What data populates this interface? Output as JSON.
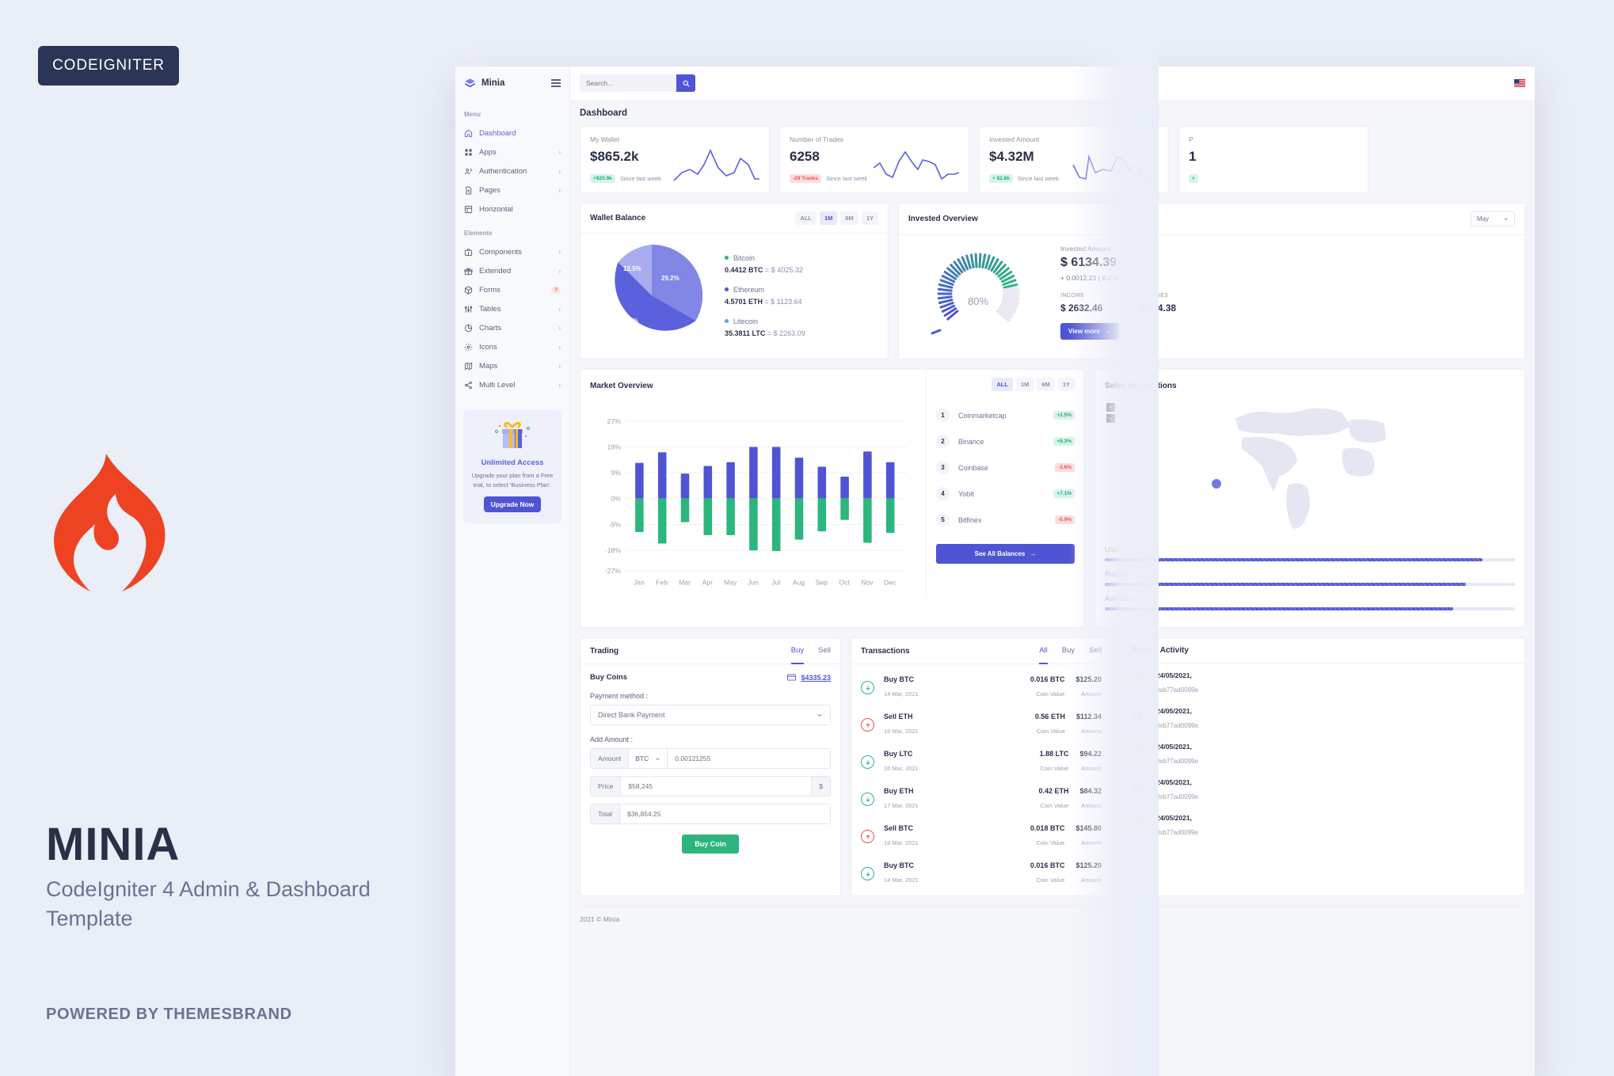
{
  "promo": {
    "badge": "CODEIGNITER",
    "title": "MINIA",
    "subtitle": "CodeIgniter 4 Admin & Dashboard Template",
    "powered_by": "POWERED BY THEMESBRAND",
    "flame_color": "#ee4323",
    "badge_bg": "#2b3657"
  },
  "sidebar": {
    "brand": "Minia",
    "sections": [
      {
        "label": "Menu",
        "items": [
          {
            "label": "Dashboard",
            "icon": "home-icon",
            "arrow": "",
            "active": true
          },
          {
            "label": "Apps",
            "icon": "grid-icon",
            "arrow": "›"
          },
          {
            "label": "Authentication",
            "icon": "users-icon",
            "arrow": "›"
          },
          {
            "label": "Pages",
            "icon": "file-icon",
            "arrow": "›"
          },
          {
            "label": "Horizontal",
            "icon": "layout-icon",
            "arrow": ""
          }
        ]
      },
      {
        "label": "Elements",
        "items": [
          {
            "label": "Components",
            "icon": "briefcase-icon",
            "arrow": "›"
          },
          {
            "label": "Extended",
            "icon": "gift-icon",
            "arrow": "›"
          },
          {
            "label": "Forms",
            "icon": "box-icon",
            "badge": "7"
          },
          {
            "label": "Tables",
            "icon": "sliders-icon",
            "arrow": "›"
          },
          {
            "label": "Charts",
            "icon": "pie-chart-icon",
            "arrow": "›"
          },
          {
            "label": "Icons",
            "icon": "gear-icon",
            "arrow": "›"
          },
          {
            "label": "Maps",
            "icon": "map-icon",
            "arrow": "›"
          },
          {
            "label": "Multi Level",
            "icon": "share-icon",
            "arrow": "›"
          }
        ]
      }
    ],
    "promo": {
      "title": "Unlimited Access",
      "text": "Upgrade your plan from a Free trial, to select 'Business Plan'.",
      "button": "Upgrade Now"
    }
  },
  "topbar": {
    "search_placeholder": "Search...",
    "search_icon": "search-icon",
    "flag_icon": "usa-flag-icon"
  },
  "main": {
    "page_title": "Dashboard",
    "footer": "2021 © Minia",
    "stats": [
      {
        "label": "My Wallet",
        "value": "$865.2k",
        "pill": "+$20.9k",
        "pill_dir": "up",
        "since": "Since last week"
      },
      {
        "label": "Number of Trades",
        "value": "6258",
        "pill": "-29 Trades",
        "pill_dir": "down",
        "since": "Since last week"
      },
      {
        "label": "Invested Amount",
        "value": "$4.32M",
        "pill": "+ $2.8k",
        "pill_dir": "up",
        "since": "Since last week"
      },
      {
        "label": "P",
        "value": "1",
        "pill": "+",
        "pill_dir": "up",
        "since": ""
      }
    ],
    "wallet": {
      "title": "Wallet Balance",
      "ranges": [
        "ALL",
        "1M",
        "6M",
        "1Y"
      ],
      "active_range": "1M",
      "coins": [
        {
          "name": "Bitcoin",
          "color": "#2cb67d",
          "amount": "0.4412 BTC",
          "value": "= $ 4025.32"
        },
        {
          "name": "Ethereum",
          "color": "#4f54d4",
          "amount": "4.5701 ETH",
          "value": "= $ 1123.64"
        },
        {
          "name": "Litecoin",
          "color": "#50a5f1",
          "amount": "35.3811 LTC",
          "value": "= $ 2263.09"
        }
      ]
    },
    "invested": {
      "title": "Invested Overview",
      "month": "May",
      "amount_label": "Invested Amount",
      "amount": "$ 6134.39",
      "delta": "+ 0.0012.23 ( 0.2 % )",
      "delta_arrow": "↑",
      "gauge_pct": "80%",
      "income_label": "INCOME",
      "income": "$ 2632.46",
      "expenses_label": "EXPENSES",
      "expenses": "-$ 924.38",
      "view_more": "View more",
      "view_more_arrow": "→"
    },
    "market": {
      "title": "Market Overview",
      "ranges": [
        "ALL",
        "1M",
        "6M",
        "1Y"
      ],
      "active_range": "ALL"
    },
    "balances": {
      "ranges": [
        "ALL",
        "1M",
        "6M",
        "1Y"
      ],
      "active_range": "ALL",
      "rows": [
        {
          "rank": "1",
          "name": "Coinmarketcap",
          "change": "+2.5%",
          "dir": "up"
        },
        {
          "rank": "2",
          "name": "Binance",
          "change": "+8.3%",
          "dir": "up"
        },
        {
          "rank": "3",
          "name": "Coinbase",
          "change": "-3.6%",
          "dir": "down"
        },
        {
          "rank": "4",
          "name": "Yobit",
          "change": "+7.1%",
          "dir": "up"
        },
        {
          "rank": "5",
          "name": "Bitfinex",
          "change": "-0.9%",
          "dir": "down"
        }
      ],
      "button": "See All Balances",
      "button_arrow": "→"
    },
    "locations": {
      "title": "Sales by Locations",
      "zoom_in": "+",
      "zoom_out": "−",
      "items": [
        {
          "name": "USA",
          "pct": 92
        },
        {
          "name": "Russia",
          "pct": 88
        },
        {
          "name": "Australia",
          "pct": 85
        }
      ]
    },
    "trading": {
      "title": "Trading",
      "tabs": [
        "Buy",
        "Sell"
      ],
      "active_tab": "Buy",
      "buy_coins_label": "Buy Coins",
      "wallet_icon": "wallet-icon",
      "wallet_amount": "$4335.23",
      "payment_method_label": "Payment method :",
      "payment_method_value": "Direct Bank Payment",
      "add_amount_label": "Add Amount :",
      "amount_addon": "Amount",
      "amount_currency": "BTC",
      "amount_placeholder": "0.00121255",
      "price_addon": "Price",
      "price_placeholder": "$58,245",
      "price_suffix": "$",
      "total_addon": "Total",
      "total_placeholder": "$36,854.25",
      "buy_button": "Buy Coin"
    },
    "transactions": {
      "title": "Transactions",
      "tabs": [
        "All",
        "Buy",
        "Sell"
      ],
      "active_tab": "All",
      "coin_value_label": "Coin Value",
      "amount_label": "Amount",
      "rows": [
        {
          "title": "Buy BTC",
          "date": "14 Mar, 2021",
          "coin": "0.016 BTC",
          "amount": "$125.20",
          "dir": "buy"
        },
        {
          "title": "Sell ETH",
          "date": "16 Mar, 2021",
          "coin": "0.56 ETH",
          "amount": "$112.34",
          "dir": "sell"
        },
        {
          "title": "Buy LTC",
          "date": "16 Mar, 2021",
          "coin": "1.88 LTC",
          "amount": "$94.22",
          "dir": "buy"
        },
        {
          "title": "Buy ETH",
          "date": "17 Mar, 2021",
          "coin": "0.42 ETH",
          "amount": "$84.32",
          "dir": "buy"
        },
        {
          "title": "Sell BTC",
          "date": "18 Mar, 2021",
          "coin": "0.018 BTC",
          "amount": "$145.80",
          "dir": "sell"
        },
        {
          "title": "Buy BTC",
          "date": "14 Mar, 2021",
          "coin": "0.016 BTC",
          "amount": "$125.20",
          "dir": "buy"
        }
      ]
    },
    "activity": {
      "title": "Recent Activity",
      "rows": [
        {
          "date": "24/05/2021,",
          "hash": "0xb77ad0099e",
          "coin": "B",
          "bg": "#fdecd0",
          "fg": "#f0a73e"
        },
        {
          "date": "24/05/2021,",
          "hash": "0xb77ad0099e",
          "coin": "♦",
          "bg": "#dcdef7",
          "fg": "#4f54d4"
        },
        {
          "date": "24/05/2021,",
          "hash": "0xb77ad0099e",
          "coin": "B",
          "bg": "#fdecd0",
          "fg": "#f0a73e"
        },
        {
          "date": "24/05/2021,",
          "hash": "0xb77ad0099e",
          "coin": "Ł",
          "bg": "#dcdef7",
          "fg": "#5b61dd"
        },
        {
          "date": "24/05/2021,",
          "hash": "0xb77ad0099e",
          "coin": "B",
          "bg": "#fdecd0",
          "fg": "#f0a73e"
        }
      ]
    }
  },
  "chart_data": [
    {
      "type": "pie",
      "title": "Wallet Balance",
      "labels": [
        "Ethereum",
        "Bitcoin",
        "Litecoin"
      ],
      "values": [
        58.3,
        29.2,
        12.5
      ],
      "value_labels": [
        "58.3%",
        "29.2%",
        "12.5%"
      ],
      "colors": [
        "#5b61dd",
        "#8287e6",
        "#a9adf0"
      ]
    },
    {
      "type": "bar",
      "title": "Market Overview",
      "categories": [
        "Jan",
        "Feb",
        "Mar",
        "Apr",
        "May",
        "Jun",
        "Jul",
        "Aug",
        "Sep",
        "Oct",
        "Nov",
        "Dec"
      ],
      "series": [
        {
          "name": "Gain",
          "color": "#4f54d4",
          "values": [
            12.4,
            16.2,
            8.7,
            11.5,
            12.6,
            18.0,
            18.1,
            14.3,
            11.2,
            7.8,
            16.3,
            12.8
          ]
        },
        {
          "name": "Loss",
          "color": "#2cb67d",
          "values": [
            -11.6,
            -15.6,
            -8.2,
            -12.6,
            -12.7,
            -18.0,
            -18.3,
            -14.2,
            -11.3,
            -7.3,
            -15.4,
            -11.9
          ]
        }
      ],
      "ylabel": "",
      "xlabel": "",
      "yticks": [
        "27%",
        "18%",
        "9%",
        "0%",
        "-9%",
        "-18%",
        "-27%"
      ],
      "ylim": [
        -27,
        27
      ],
      "grid": true,
      "legend": false
    },
    {
      "type": "gauge",
      "title": "Invested Overview",
      "value": 80,
      "value_label": "80%",
      "colors": [
        "#4f54d4",
        "#2cb67d"
      ]
    },
    {
      "type": "bar",
      "title": "Sales by Locations",
      "categories": [
        "USA",
        "Russia",
        "Australia"
      ],
      "values": [
        92,
        88,
        85
      ]
    }
  ]
}
